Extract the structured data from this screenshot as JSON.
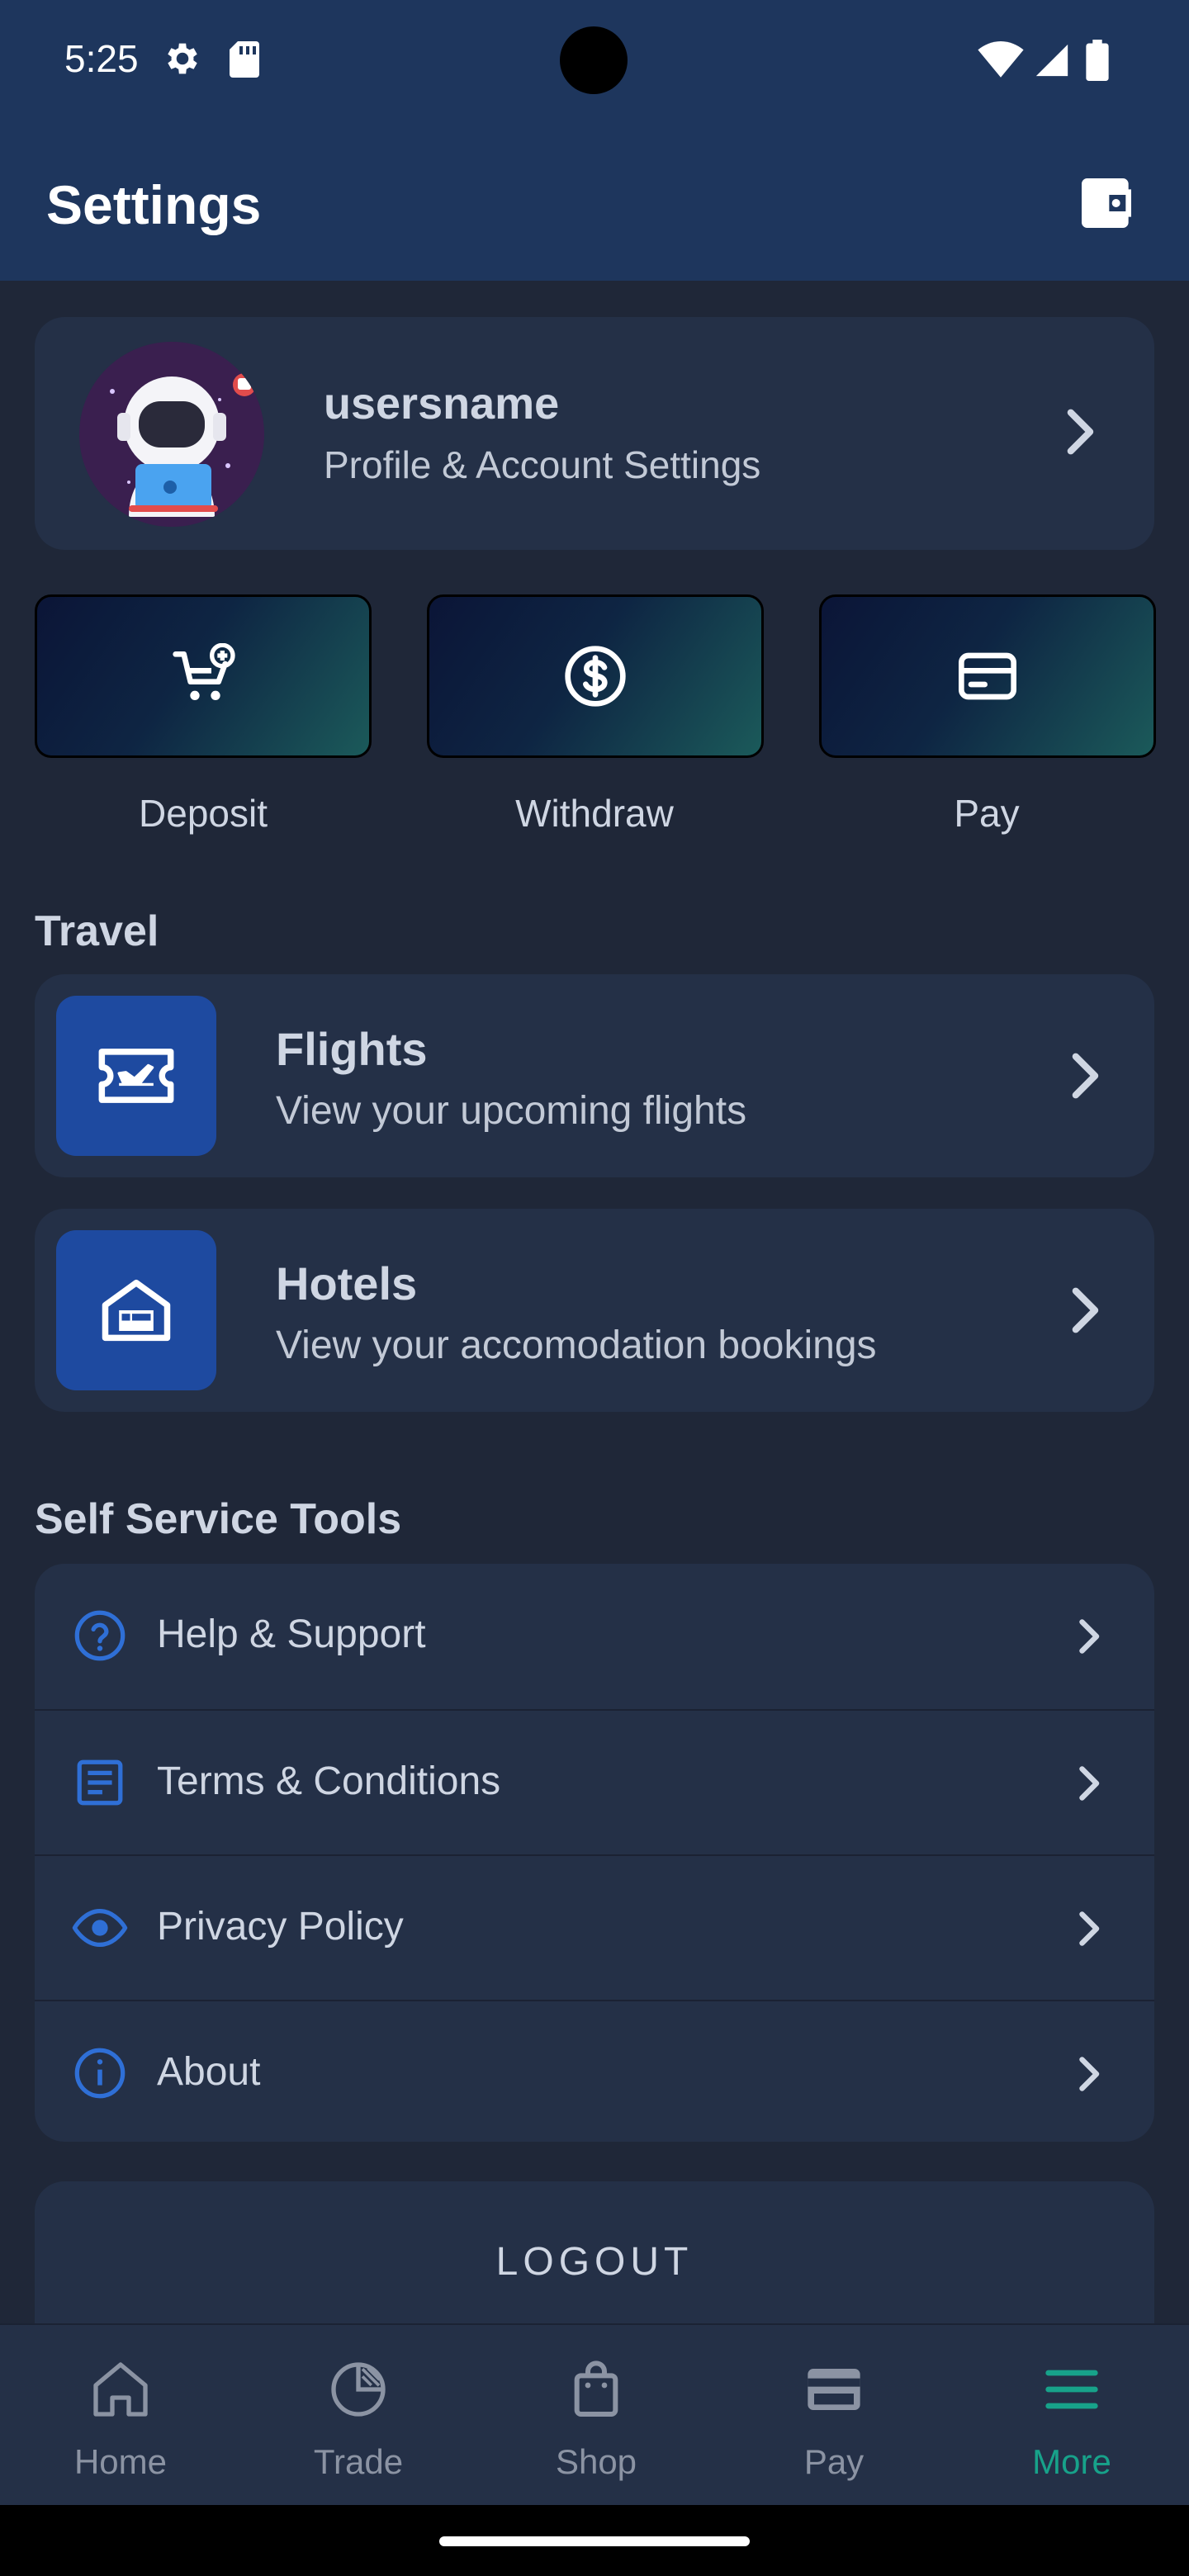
{
  "status_bar": {
    "time": "5:25",
    "icons": [
      "settings-gear-icon",
      "sd-card-icon",
      "wifi-icon",
      "signal-icon",
      "battery-icon"
    ]
  },
  "header": {
    "title": "Settings",
    "action_icon": "wallet-icon"
  },
  "profile": {
    "name": "usersname",
    "subtitle": "Profile & Account Settings",
    "avatar_icon": "astronaut-avatar"
  },
  "quick_actions": [
    {
      "label": "Deposit",
      "icon": "cart-add-icon"
    },
    {
      "label": "Withdraw",
      "icon": "dollar-circle-icon"
    },
    {
      "label": "Pay",
      "icon": "credit-card-icon"
    }
  ],
  "travel": {
    "section_title": "Travel",
    "items": [
      {
        "title": "Flights",
        "subtitle": "View your upcoming flights",
        "icon": "flight-ticket-icon"
      },
      {
        "title": "Hotels",
        "subtitle": "View your accomodation bookings",
        "icon": "hotel-icon"
      }
    ]
  },
  "tools": {
    "section_title": "Self Service Tools",
    "items": [
      {
        "label": "Help & Support",
        "icon": "help-circle-icon"
      },
      {
        "label": "Terms & Conditions",
        "icon": "document-icon"
      },
      {
        "label": "Privacy Policy",
        "icon": "eye-icon"
      },
      {
        "label": "About",
        "icon": "info-circle-icon"
      }
    ]
  },
  "logout": {
    "label": "LOGOUT"
  },
  "bottom_nav": {
    "items": [
      {
        "label": "Home",
        "icon": "home-icon",
        "active": false
      },
      {
        "label": "Trade",
        "icon": "pie-chart-icon",
        "active": false
      },
      {
        "label": "Shop",
        "icon": "shopping-bag-icon",
        "active": false
      },
      {
        "label": "Pay",
        "icon": "credit-card-icon",
        "active": false
      },
      {
        "label": "More",
        "icon": "menu-icon",
        "active": true
      }
    ]
  },
  "colors": {
    "header_bg": "#1e365d",
    "page_bg": "#1f2738",
    "card_bg": "#243047",
    "accent_blue": "#1e4aa0",
    "icon_blue": "#2f6fd6",
    "active_nav": "#17a28a"
  }
}
